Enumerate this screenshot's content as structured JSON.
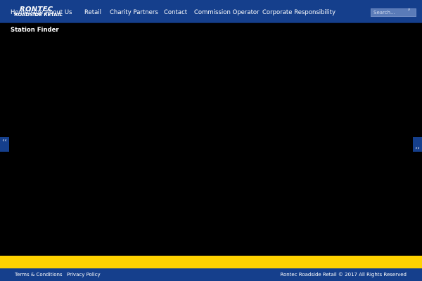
{
  "brand": {
    "name": "RONTEC",
    "tagline": "ROADSIDE RETAIL"
  },
  "nav": {
    "items": [
      {
        "label": "Homepage"
      },
      {
        "label": "About Us"
      },
      {
        "label": "Retail"
      },
      {
        "label": "Charity Partners"
      },
      {
        "label": "Contact"
      },
      {
        "label": "Commission Operator"
      },
      {
        "label": "Corporate Responsibility"
      }
    ]
  },
  "search": {
    "placeholder": "Search...",
    "icon": "search-icon"
  },
  "page": {
    "title": "Station Finder"
  },
  "slider": {
    "prev_label": "‹‹",
    "next_label": "››"
  },
  "footer": {
    "links": [
      {
        "label": "Terms & Conditions"
      },
      {
        "label": "Privacy Policy"
      }
    ],
    "copyright": "Rontec Roadside Retail © 2017 All Rights Reserved"
  },
  "colors": {
    "header_bg": "#153f8c",
    "accent_yellow": "#ffd200",
    "page_bg": "#000000"
  }
}
